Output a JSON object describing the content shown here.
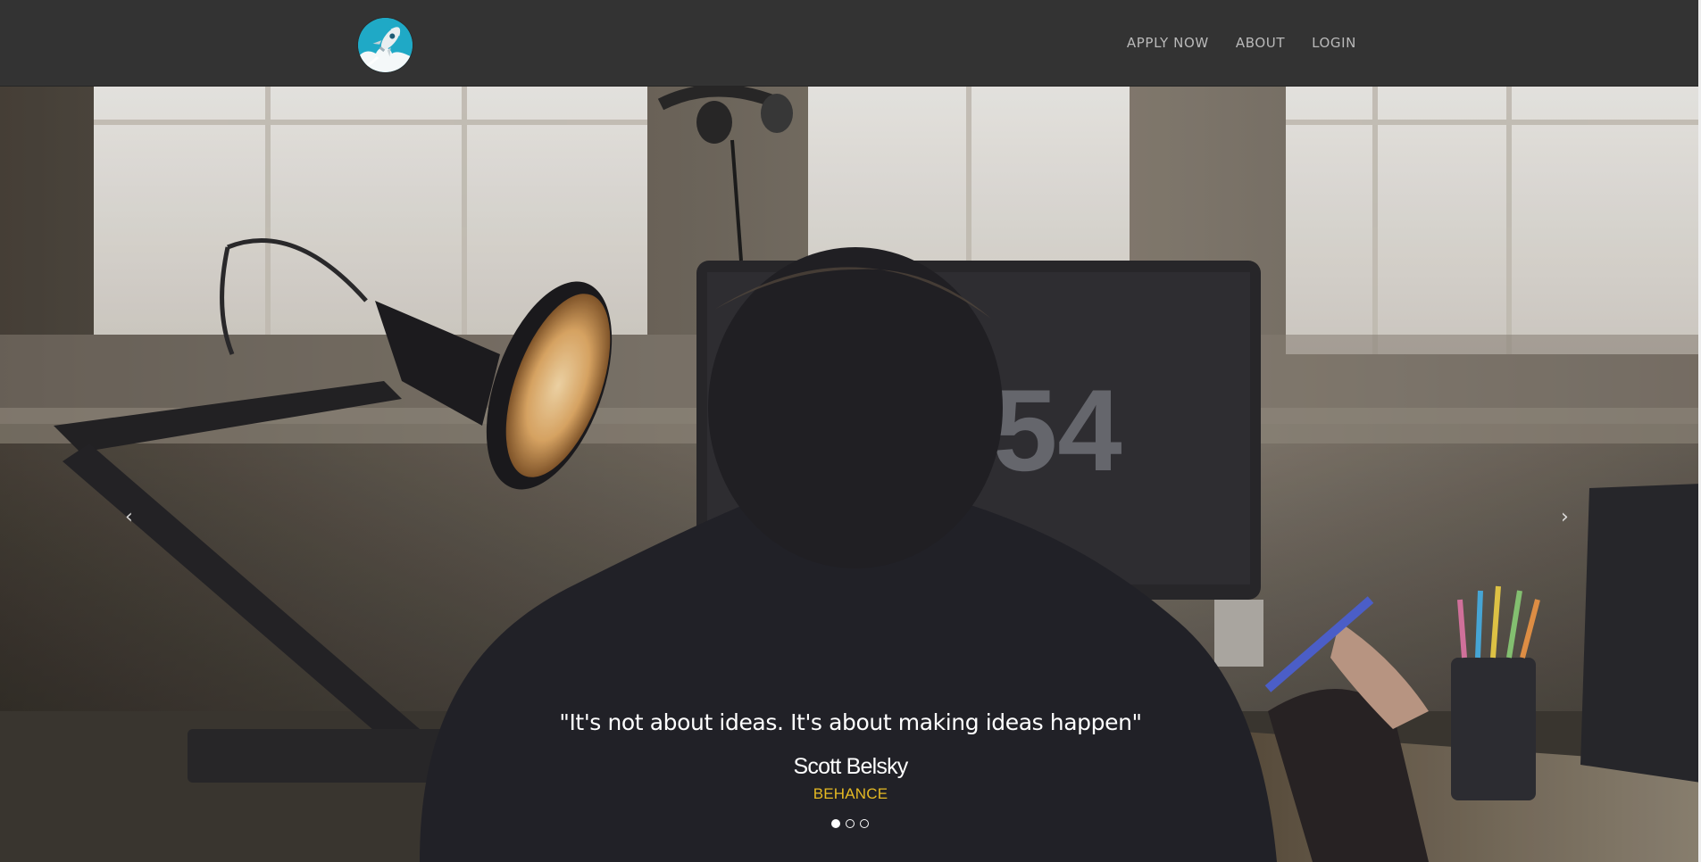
{
  "brand": {
    "logo_icon": "rocket-icon",
    "colors": {
      "logo_bg": "#1fa9c6",
      "nav_bg": "#333333"
    }
  },
  "nav": {
    "items": [
      {
        "label": "APPLY NOW"
      },
      {
        "label": "ABOUT"
      },
      {
        "label": "LOGIN"
      }
    ]
  },
  "hero": {
    "image": "photo-man-at-desk-with-lamp-and-monitor",
    "prev_icon": "chevron-left-icon",
    "next_icon": "chevron-right-icon",
    "prev_glyph": "‹",
    "next_glyph": "›",
    "quote": "\"It's not about ideas. It's about making ideas happen\"",
    "author": "Scott Belsky",
    "company": "BEHANCE",
    "company_color": "#e5b923",
    "slides": {
      "count": 3,
      "active": 1
    }
  }
}
